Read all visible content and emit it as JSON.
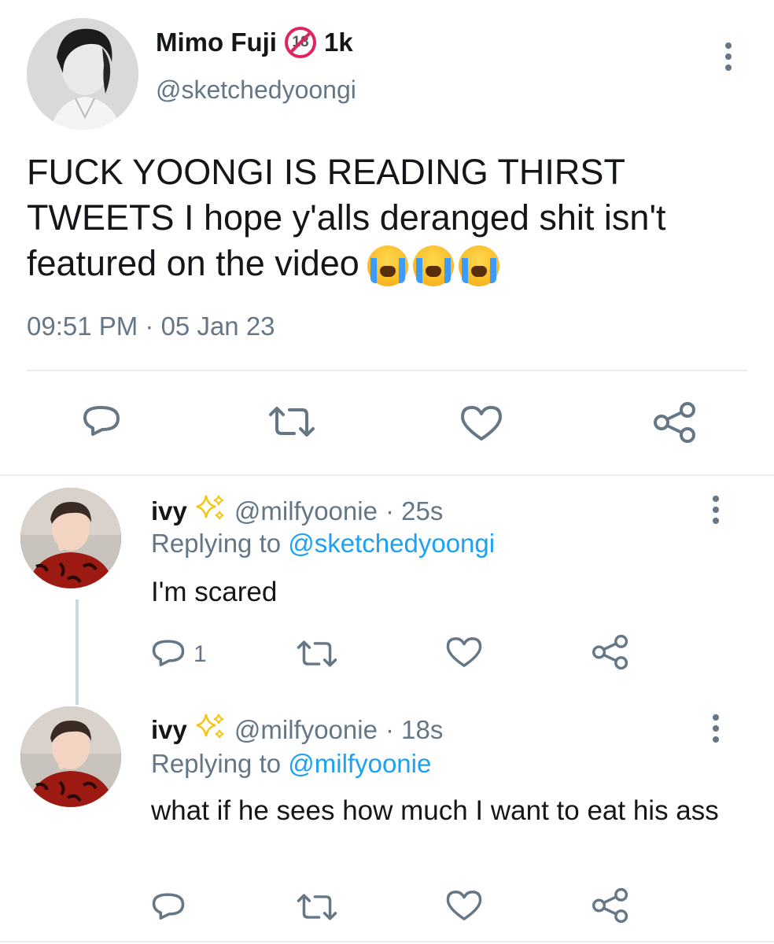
{
  "main_tweet": {
    "display_name": "Mimo Fuji",
    "badge_text": "18",
    "follower_count": "1k",
    "handle": "@sketchedyoongi",
    "text": "FUCK YOONGI IS READING THIRST TWEETS I hope y'alls deranged shit isn't featured on the video",
    "emoji_icon": "loudly-crying-face-icon",
    "timestamp": "09:51 PM · 05 Jan 23",
    "actions": [
      "reply-icon",
      "retweet-icon",
      "like-icon",
      "share-icon"
    ]
  },
  "replies": [
    {
      "name": "ivy",
      "name_emoji": "sparkles-icon",
      "handle": "@milfyoonie",
      "age": "· 25s",
      "replying_prefix": "Replying to ",
      "replying_to": "@sketchedyoongi",
      "text": "I'm scared",
      "reply_count": "1"
    },
    {
      "name": "ivy",
      "name_emoji": "sparkles-icon",
      "handle": "@milfyoonie",
      "age": "· 18s",
      "replying_prefix": "Replying to ",
      "replying_to": "@milfyoonie",
      "text": "what if he sees how much I want to eat his ass",
      "reply_count": ""
    }
  ],
  "colors": {
    "text": "#14171a",
    "muted": "#657786",
    "link": "#1da1f2",
    "divider": "#e6ecf0",
    "sparkle": "#f5c518",
    "nsfw_badge": "#e0245e"
  }
}
